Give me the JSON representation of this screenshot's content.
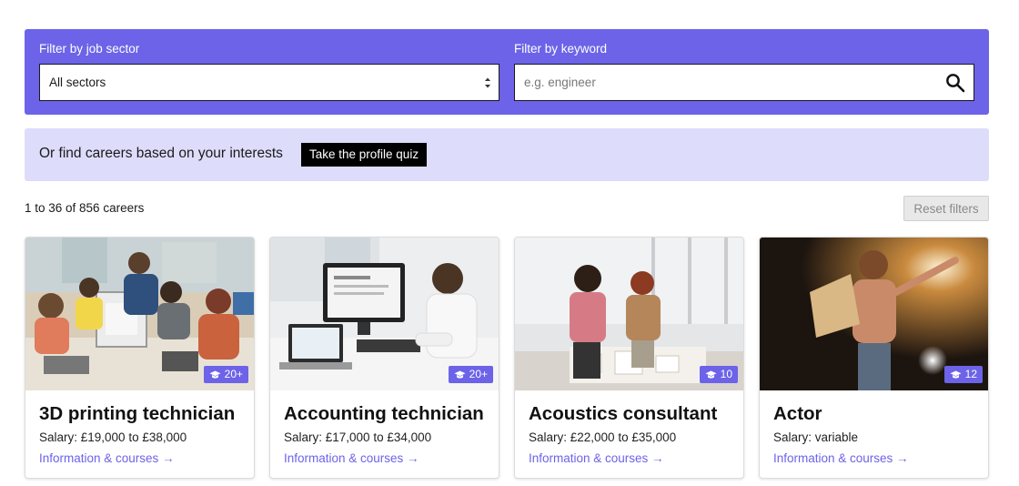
{
  "filters": {
    "sector_label": "Filter by job sector",
    "sector_value": "All sectors",
    "keyword_label": "Filter by keyword",
    "keyword_placeholder": "e.g. engineer"
  },
  "quiz": {
    "text": "Or find careers based on your interests",
    "button": "Take the profile quiz"
  },
  "results": {
    "count": "1 to 36 of 856 careers",
    "reset": "Reset filters"
  },
  "colors": {
    "accent": "#6c63e8",
    "banner": "#dedcfb"
  },
  "cards": [
    {
      "title": "3D printing technician",
      "salary": "Salary: £19,000 to £38,000",
      "badge": "20+",
      "link": "Information & courses →",
      "image": "students-3d-printer-photo"
    },
    {
      "title": "Accounting technician",
      "salary": "Salary: £17,000 to £34,000",
      "badge": "20+",
      "link": "Information & courses →",
      "image": "office-computer-desk-photo"
    },
    {
      "title": "Acoustics consultant",
      "salary": "Salary: £22,000 to £35,000",
      "badge": "10",
      "link": "Information & courses →",
      "image": "architects-model-photo"
    },
    {
      "title": "Actor",
      "salary": "Salary: variable",
      "badge": "12",
      "link": "Information & courses →",
      "image": "actor-stage-script-photo"
    }
  ]
}
